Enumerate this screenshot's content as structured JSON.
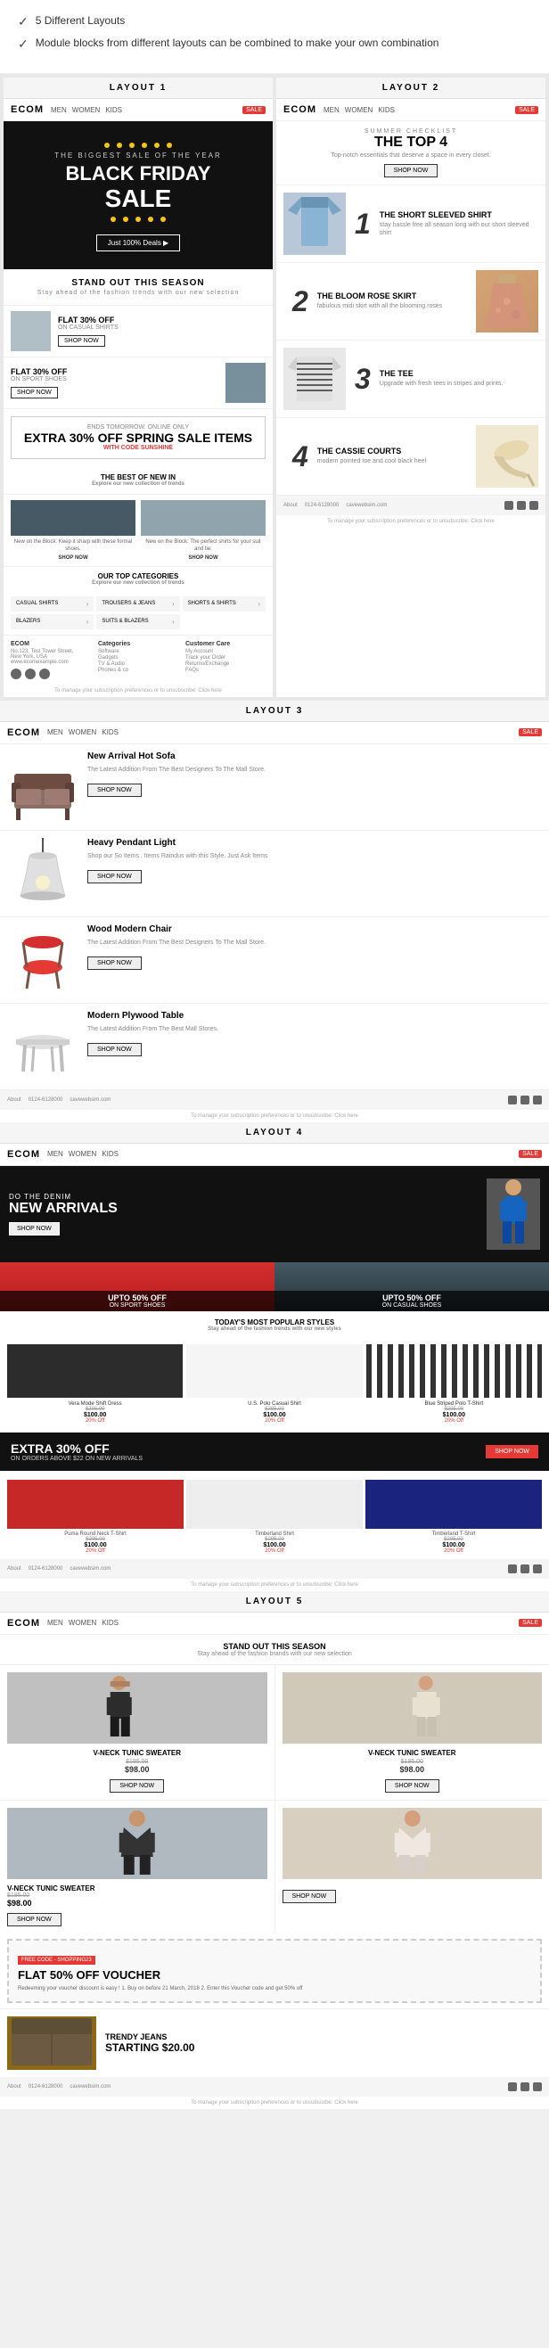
{
  "header": {
    "checks": [
      "5 Different Layouts",
      "Module blocks from different layouts can be combined to make your own combination"
    ]
  },
  "layout1": {
    "label": "LAYOUT 1",
    "nav": {
      "logo": "ECOM",
      "links": [
        "MEN",
        "WOMEN",
        "KIDS"
      ],
      "badge": "SALE"
    },
    "hero": {
      "subtitle": "THE BIGGEST SALE OF THE YEAR",
      "title": "BLACK FRIDAY",
      "sale": "SALE",
      "btn": "Just 100% Deals ▶"
    },
    "standOut": {
      "title": "STAND OUT THIS SEASON",
      "sub": "Stay ahead of the fashion trends with our new selection"
    },
    "promo1": {
      "off": "FLAT 30% OFF",
      "cat": "ON CASUAL SHIRTS",
      "btn": "SHOP NOW"
    },
    "promo2": {
      "off": "FLAT 30% OFF",
      "cat": "ON SPORT SHOES",
      "btn": "SHOP NOW"
    },
    "springSale": {
      "ends": "ENDS TOMORROW. ONLINE ONLY",
      "extra": "EXTRA 30% OFF SPRING SALE ITEMS",
      "with": "WITH CODE",
      "code": "SUNSHINE"
    },
    "bestNew": {
      "title": "THE BEST OF NEW IN",
      "sub": "Explore our new collection of trends"
    },
    "products": [
      {
        "desc": "New on the Block: Keep it sharp with these formal shoes.",
        "shop": "SHOP NOW"
      },
      {
        "desc": "New on the Block: The perfect shirts for your suit and tie.",
        "shop": "SHOP NOW"
      }
    ],
    "topCats": {
      "title": "OUR TOP CATEGORIES",
      "sub": "Explore our new collection of trends"
    },
    "categories": [
      "CASUAL SHIRTS",
      "TROUSERS & JEANS",
      "SHORTS & SHIRTS",
      "BLAZERS",
      "SUITS & BLAZERS"
    ],
    "footer": {
      "address": "No.123, Test Tower Street, New\nYork, USA\nwww.ecomexample.com",
      "categories_title": "Categories",
      "categories": [
        "Software",
        "Gadgets",
        "TV & Audio",
        "Phones & co"
      ],
      "customer_title": "Customer Care",
      "customer": [
        "My Account",
        "Track your Order",
        "Returns/Exchange",
        "FAQs"
      ]
    },
    "footerNote": "To manage your subscription preferences or to unsubscribe: Click here"
  },
  "layout2": {
    "label": "LAYOUT 2",
    "nav": {
      "logo": "ECOM",
      "links": [
        "MEN",
        "WOMEN",
        "KIDS"
      ],
      "badge": "SALE"
    },
    "hero": {
      "label": "SUMMER CHECKLIST",
      "title": "THE TOP 4",
      "sub": "Top-notch essentials that deserve a space in every closet.",
      "btn": "SHOP NOW"
    },
    "products": [
      {
        "num": "1",
        "name": "THE SHORT SLEEVED SHIRT",
        "desc": "stay hassle free all season long with our short sleeved shirt"
      },
      {
        "num": "2",
        "name": "THE BLOOM ROSE SKIRT",
        "desc": "fabulous midi skirt with all the blooming roses"
      },
      {
        "num": "3",
        "name": "THE TEE",
        "desc": "Upgrade with fresh tees in stripes and prints."
      },
      {
        "num": "4",
        "name": "THE CASSIE COURTS",
        "desc": "modern pointed toe and cool black heel"
      }
    ],
    "footer": {
      "about": "About",
      "phone": "0124-6128000",
      "site": "cavewebsim.com",
      "note": "To manage your subscription preferences or to unsubscribe: Click here"
    }
  },
  "layout3": {
    "label": "LAYOUT 3",
    "nav": {
      "logo": "ECOM",
      "links": [
        "MEN",
        "WOMEN",
        "KIDS"
      ],
      "badge": "SALE"
    },
    "products": [
      {
        "name": "New Arrival Hot Sofa",
        "desc": "The Latest Addition From The Best Designers To The Mall Store.",
        "btn": "SHOP NOW"
      },
      {
        "name": "Heavy Pendant Light",
        "desc": "Shop our So Items . Items Raindus with this Style. Just Ask Items",
        "btn": "SHOP NOW"
      },
      {
        "name": "Wood Modern Chair",
        "desc": "The Latest Addition From The Best Designers To The Mall Store.",
        "btn": "SHOP NOW"
      },
      {
        "name": "Modern Plywood Table",
        "desc": "The Latest Addition From The Best Mall Stores.",
        "btn": "SHOP NOW"
      }
    ],
    "footer": {
      "about": "About",
      "phone": "0124-6128000",
      "site": "cavewebsim.com",
      "note": "To manage your subscription preferences or to unsubscribe: Click here"
    }
  },
  "layout4": {
    "label": "LAYOUT 4",
    "nav": {
      "logo": "ECOM",
      "links": [
        "MEN",
        "WOMEN",
        "KIDS"
      ],
      "badge": "SALE"
    },
    "hero": {
      "sub": "DO THE DENIM",
      "title": "NEW ARRIVALS",
      "btn": "SHOP NOW"
    },
    "shoes": [
      {
        "label": "UPTO 50% OFF",
        "cat": "ON SPORT SHOES"
      },
      {
        "label": "UPTO 50% OFF",
        "cat": "ON CASUAL SHOES"
      }
    ],
    "popular": {
      "title": "TODAY'S MOST POPULAR STYLES",
      "sub": "Stay ahead of the fashion trends with our new styles"
    },
    "styles": [
      {
        "name": "Vera Mode Shift Dress",
        "old": "$295.00",
        "price": "$100.00",
        "off": "20% Off"
      },
      {
        "name": "U.S. Polo Casual Shirt",
        "old": "$295.00",
        "price": "$100.00",
        "off": "20% Off"
      },
      {
        "name": "Blue Striped Polo T-Shirt",
        "old": "$295.00",
        "price": "$100.00",
        "off": "20% Off"
      }
    ],
    "extra30": {
      "title": "EXTRA 30% OFF",
      "sub": "ON ORDERS ABOVE $22 ON NEW ARRIVALS",
      "btn": "SHOP NOW"
    },
    "tshirts": [
      {
        "name": "Puma Round Neck T-Shirt",
        "old": "$295.00",
        "price": "$100.00",
        "off": "20% Off"
      },
      {
        "name": "Timberland Shirt",
        "old": "$295.00",
        "price": "$100.00",
        "off": "20% Off"
      },
      {
        "name": "Timberland T-Shirt",
        "old": "$295.00",
        "price": "$100.00",
        "off": "20% Off"
      }
    ],
    "footer": {
      "about": "About",
      "phone": "0124-6128000",
      "site": "cavewebsim.com",
      "note": "To manage your subscription preferences or to unsubscribe: Click here"
    }
  },
  "layout5": {
    "label": "LAYOUT 5",
    "nav": {
      "logo": "ECOM",
      "links": [
        "MEN",
        "WOMEN",
        "KIDS"
      ],
      "badge": "SALE"
    },
    "standOut": {
      "title": "STAND OUT THIS SEASON",
      "sub": "Stay ahead of the fashion brands with our new selection"
    },
    "products": [
      {
        "name": "V-NECK TUNIC SWEATER",
        "old": "$195.00",
        "price": "$98.00",
        "btn": "SHOP NOW"
      }
    ],
    "vneck": [
      {
        "name": "V-NECK TUNIC SWEATER",
        "old": "$195.00",
        "price": "$98.00",
        "btn": "SHOP NOW"
      },
      {
        "name": "",
        "old": "",
        "price": "",
        "btn": "SHOP NOW"
      }
    ],
    "voucher": {
      "badge": "FREE CODE - SHOPPING23",
      "title": "FLAT 50% OFF VOUCHER",
      "desc": "Redeeming your voucher discount is easy ! 1. Buy on before 21 March, 2018 2. Enter this Voucher code and get 50% off"
    },
    "trendy": {
      "title": "TRENDY JEANS",
      "price": "STARTING $20.00",
      "sub": ""
    },
    "footer": {
      "about": "About",
      "phone": "0124-6128000",
      "site": "cavewebsim.com",
      "note": "To manage your subscription preferences or to unsubscribe: Click here"
    }
  }
}
